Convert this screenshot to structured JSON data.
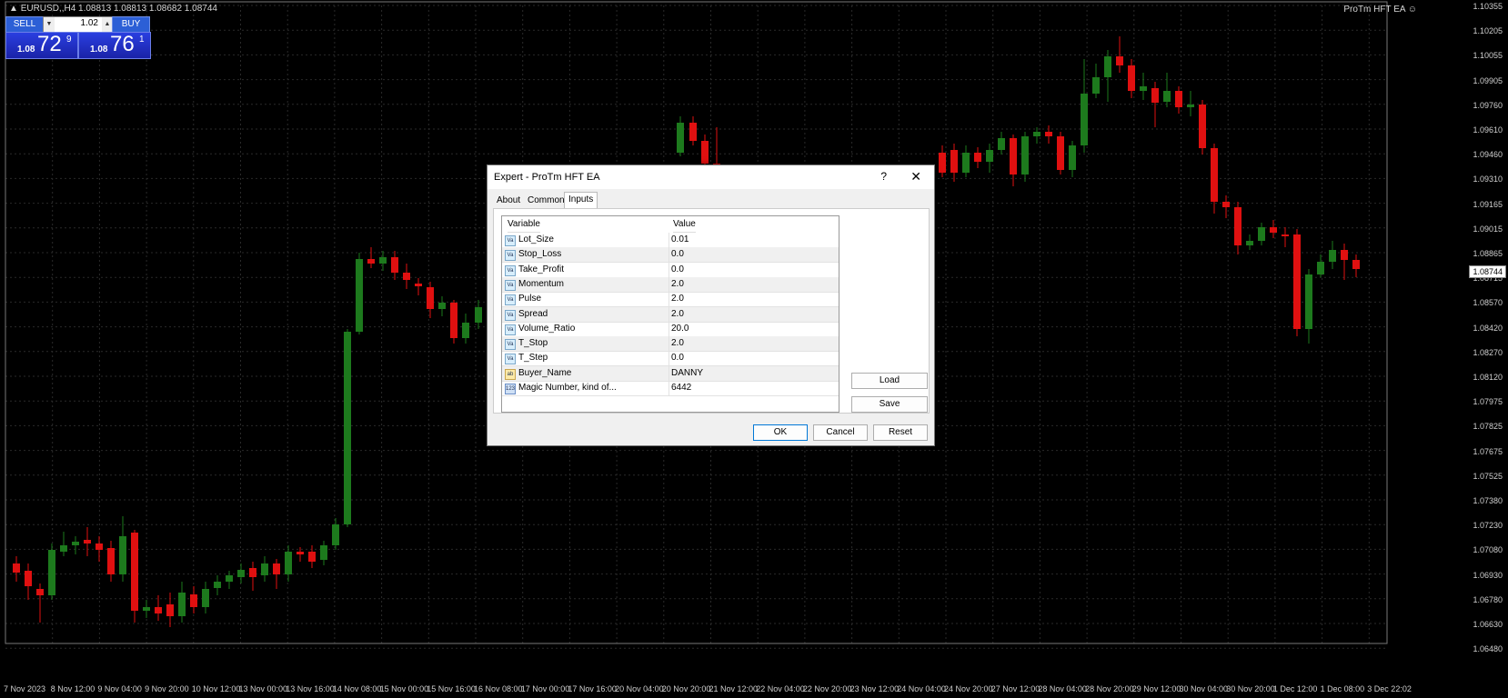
{
  "chart": {
    "symbol_bar": "EURUSD,,H4  1.08813 1.08813 1.08682 1.08744",
    "ea_label": "ProTm HFT EA",
    "ea_icon": "smiley-icon",
    "current_price": "1.08744",
    "price_axis": [
      "1.10355",
      "1.10205",
      "1.10055",
      "1.09905",
      "1.09760",
      "1.09610",
      "1.09460",
      "1.09310",
      "1.09165",
      "1.09015",
      "1.08865",
      "1.08715",
      "1.08570",
      "1.08420",
      "1.08270",
      "1.08120",
      "1.07975",
      "1.07825",
      "1.07675",
      "1.07525",
      "1.07380",
      "1.07230",
      "1.07080",
      "1.06930",
      "1.06780",
      "1.06630",
      "1.06480"
    ],
    "time_axis": [
      "7 Nov 2023",
      "8 Nov 12:00",
      "9 Nov 04:00",
      "9 Nov 20:00",
      "10 Nov 12:00",
      "13 Nov 00:00",
      "13 Nov 16:00",
      "14 Nov 08:00",
      "15 Nov 00:00",
      "15 Nov 16:00",
      "16 Nov 08:00",
      "17 Nov 00:00",
      "17 Nov 16:00",
      "20 Nov 04:00",
      "20 Nov 20:00",
      "21 Nov 12:00",
      "22 Nov 04:00",
      "22 Nov 20:00",
      "23 Nov 12:00",
      "24 Nov 04:00",
      "24 Nov 20:00",
      "27 Nov 12:00",
      "28 Nov 04:00",
      "28 Nov 20:00",
      "29 Nov 12:00",
      "30 Nov 04:00",
      "30 Nov 20:00",
      "1 Dec 12:00",
      "1 Dec 08:00",
      "3 Dec 22:02"
    ],
    "colors": {
      "bull": "#1d7a1d",
      "bear": "#e01010",
      "grid": "#2a2a2a",
      "background": "#000000"
    }
  },
  "trade_panel": {
    "sell_label": "SELL",
    "buy_label": "BUY",
    "lot_value": "1.02",
    "sell_small": "1.08",
    "sell_big": "72",
    "sell_sup": "9",
    "buy_small": "1.08",
    "buy_big": "76",
    "buy_sup": "1"
  },
  "dialog": {
    "title": "Expert - ProTm HFT EA",
    "help": "?",
    "close": "✕",
    "tabs": [
      "About",
      "Common",
      "Inputs"
    ],
    "active_tab": "Inputs",
    "columns": [
      "Variable",
      "Value"
    ],
    "params": [
      {
        "icon": "Va",
        "name": "Lot_Size",
        "value": "0.01"
      },
      {
        "icon": "Va",
        "name": "Stop_Loss",
        "value": "0.0"
      },
      {
        "icon": "Va",
        "name": "Take_Profit",
        "value": "0.0"
      },
      {
        "icon": "Va",
        "name": "Momentum",
        "value": "2.0"
      },
      {
        "icon": "Va",
        "name": "Pulse",
        "value": "2.0"
      },
      {
        "icon": "Va",
        "name": "Spread",
        "value": "2.0"
      },
      {
        "icon": "Va",
        "name": "Volume_Ratio",
        "value": "20.0"
      },
      {
        "icon": "Va",
        "name": "T_Stop",
        "value": "2.0"
      },
      {
        "icon": "Va",
        "name": "T_Step",
        "value": "0.0"
      },
      {
        "icon": "ab",
        "name": "Buyer_Name",
        "value": "DANNY"
      },
      {
        "icon": "123",
        "name": "Magic Number, kind of...",
        "value": "6442"
      }
    ],
    "load_label": "Load",
    "save_label": "Save",
    "ok_label": "OK",
    "cancel_label": "Cancel",
    "reset_label": "Reset"
  }
}
